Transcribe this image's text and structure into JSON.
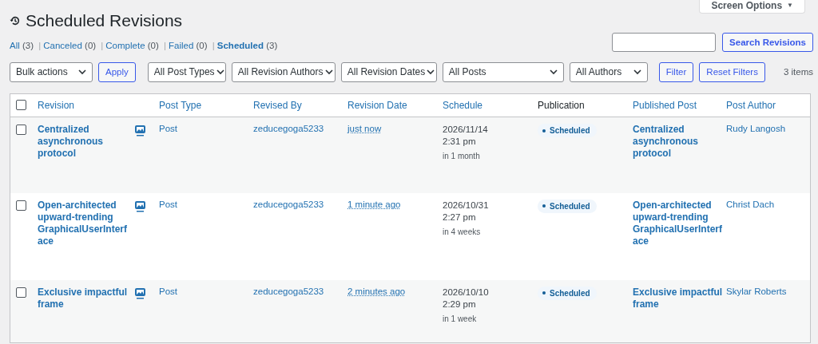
{
  "screen_options": {
    "label": "Screen Options",
    "caret": "▼"
  },
  "title": "Scheduled Revisions",
  "views": [
    {
      "label": "All",
      "count": "(3)",
      "selected": false
    },
    {
      "separator": "|",
      "label": "Canceled",
      "count": "(0)",
      "selected": false
    },
    {
      "separator": "|",
      "label": "Complete",
      "count": "(0)",
      "selected": false
    },
    {
      "separator": "|",
      "label": "Failed",
      "count": "(0)",
      "selected": false
    },
    {
      "separator": "|",
      "label": "Scheduled",
      "count": "(3)",
      "selected": true
    }
  ],
  "search": {
    "button": "Search Revisions"
  },
  "toolbar": [
    {
      "kind": "select",
      "label": "Bulk actions"
    },
    {
      "kind": "button",
      "label": "Apply"
    },
    {
      "kind": "select",
      "label": "All Post Types"
    },
    {
      "kind": "select",
      "label": "All Revision Authors"
    },
    {
      "kind": "select",
      "label": "All Revision Dates"
    },
    {
      "kind": "select",
      "label": "All Posts"
    },
    {
      "kind": "select",
      "label": "All Authors"
    },
    {
      "kind": "button",
      "label": "Filter"
    },
    {
      "kind": "button",
      "label": "Reset Filters"
    }
  ],
  "item_count": "3 items",
  "table": {
    "columns": [
      {
        "label": "Revision",
        "sortable": true
      },
      {
        "label": "Post Type",
        "sortable": true
      },
      {
        "label": "Revised By",
        "sortable": true
      },
      {
        "label": "Revision Date",
        "sortable": true
      },
      {
        "label": "Schedule",
        "sortable": true
      },
      {
        "label": "Publication",
        "sortable": false
      },
      {
        "label": "Published Post",
        "sortable": true
      },
      {
        "label": "Post Author",
        "sortable": true
      }
    ],
    "header_checked": false,
    "rows": [
      {
        "checked": false,
        "revision": "Centralized asynchronous protocol",
        "post_type": "Post",
        "revised_by": "zeducegoga5233",
        "revision_date": "just now",
        "schedule_date": "2026/11/14",
        "schedule_time": "2:31 pm",
        "schedule_relative": "in 1 month",
        "publication": "Scheduled",
        "published_post": "Centralized asynchronous protocol",
        "post_author": "Rudy Langosh"
      },
      {
        "checked": false,
        "revision": "Open-architected upward-trending GraphicalUserInterface",
        "post_type": "Post",
        "revised_by": "zeducegoga5233",
        "revision_date": "1 minute ago",
        "schedule_date": "2026/10/31",
        "schedule_time": "2:27 pm",
        "schedule_relative": "in 4 weeks",
        "publication": "Scheduled",
        "published_post": "Open-architected upward-trending GraphicalUserInterface",
        "post_author": "Christ Dach"
      },
      {
        "checked": false,
        "revision": "Exclusive impactful frame",
        "post_type": "Post",
        "revised_by": "zeducegoga5233",
        "revision_date": "2 minutes ago",
        "schedule_date": "2026/10/10",
        "schedule_time": "2:29 pm",
        "schedule_relative": "in 1 week",
        "publication": "Scheduled",
        "published_post": "Exclusive impactful frame",
        "post_author": "Skylar Roberts"
      }
    ]
  }
}
